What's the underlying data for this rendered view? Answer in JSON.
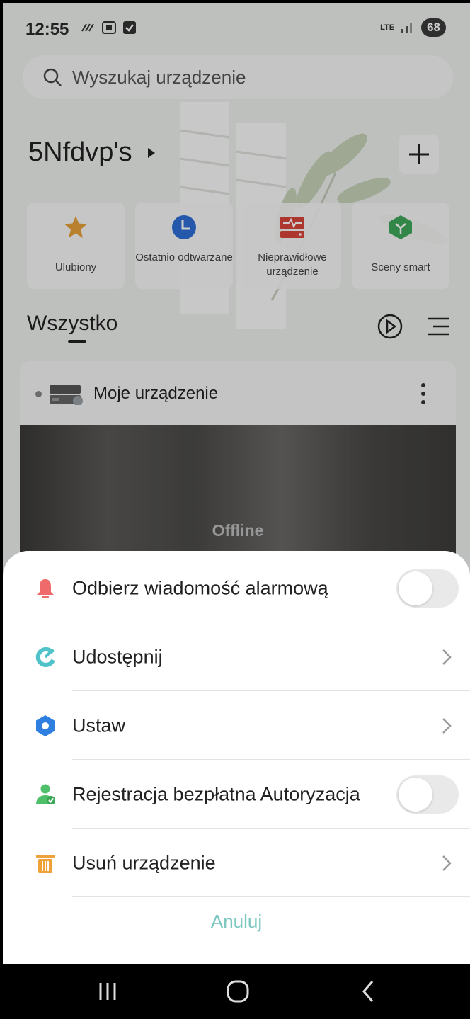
{
  "status_bar": {
    "time": "12:55",
    "network": "LTE",
    "battery": "68"
  },
  "search": {
    "placeholder": "Wyszukaj urządzenie"
  },
  "home": {
    "name": "5Nfdvp's"
  },
  "categories": [
    {
      "label": "Ulubiony",
      "icon": "star-icon",
      "color": "#e8a23a"
    },
    {
      "label": "Ostatnio odtwarzane",
      "icon": "clock-icon",
      "color": "#2f6fd6"
    },
    {
      "label": "Nieprawidłowe urządzenie",
      "icon": "abnormal-device-icon",
      "color": "#d9453a"
    },
    {
      "label": "Sceny smart",
      "icon": "cube-icon",
      "color": "#3fa85a"
    }
  ],
  "tabs": {
    "all": "Wszystko"
  },
  "device": {
    "name": "Moje urządzenie",
    "status": "Offline"
  },
  "sheet": {
    "items": [
      {
        "label": "Odbierz wiadomość alarmową",
        "icon": "bell-icon",
        "control": "toggle",
        "on": false
      },
      {
        "label": "Udostępnij",
        "icon": "share-icon",
        "control": "chevron"
      },
      {
        "label": "Ustaw",
        "icon": "settings-icon",
        "control": "chevron"
      },
      {
        "label": "Rejestracja bezpłatna Autoryzacja",
        "icon": "user-check-icon",
        "control": "toggle",
        "on": false
      },
      {
        "label": "Usuń urządzenie",
        "icon": "trash-icon",
        "control": "chevron"
      }
    ],
    "cancel_label": "Anuluj"
  },
  "colors": {
    "accent": "#7cc8c0",
    "bell": "#ef6a6a",
    "share": "#4fc3c9",
    "settings": "#2f7fe0",
    "user": "#4fbf6a",
    "trash": "#f0a23a"
  }
}
